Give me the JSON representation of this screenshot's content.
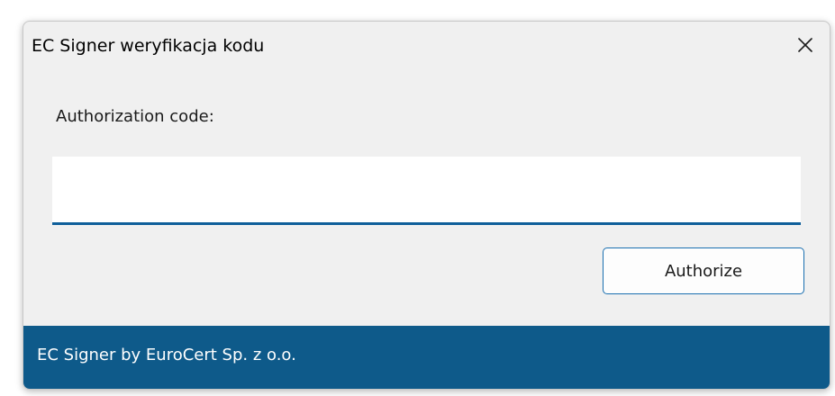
{
  "window": {
    "title": "EC Signer weryfikacja kodu",
    "close_glyph": "✕"
  },
  "form": {
    "label": "Authorization code:",
    "input_value": "",
    "input_placeholder": "",
    "authorize_label": "Authorize"
  },
  "footer": {
    "text": "EC Signer by EuroCert Sp. z o.o."
  },
  "colors": {
    "accent": "#0f5f9a",
    "footer_bg": "#0e5a8a",
    "window_bg": "#f0f0f0"
  },
  "icons": {
    "close": "close-icon"
  }
}
